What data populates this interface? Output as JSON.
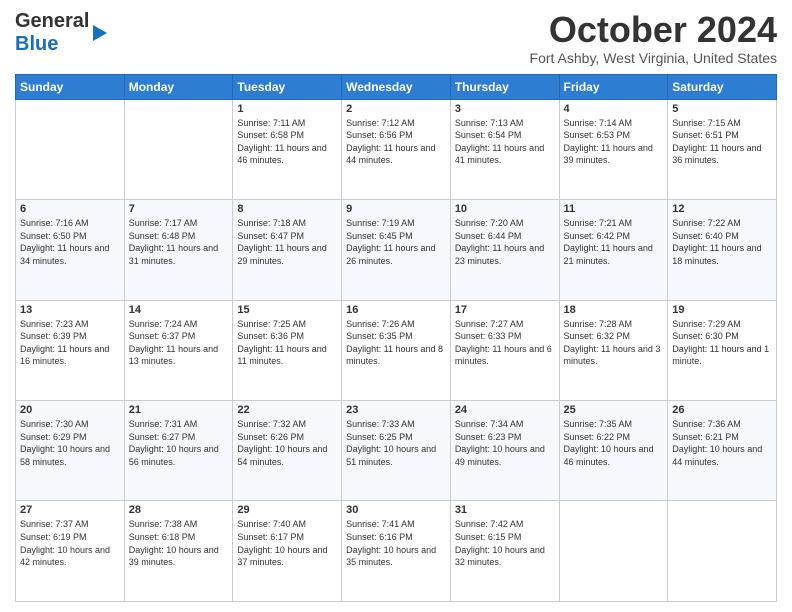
{
  "header": {
    "logo_general": "General",
    "logo_blue": "Blue",
    "title": "October 2024",
    "location": "Fort Ashby, West Virginia, United States"
  },
  "columns": [
    "Sunday",
    "Monday",
    "Tuesday",
    "Wednesday",
    "Thursday",
    "Friday",
    "Saturday"
  ],
  "weeks": [
    [
      {
        "day": "",
        "info": ""
      },
      {
        "day": "",
        "info": ""
      },
      {
        "day": "1",
        "info": "Sunrise: 7:11 AM\nSunset: 6:58 PM\nDaylight: 11 hours and 46 minutes."
      },
      {
        "day": "2",
        "info": "Sunrise: 7:12 AM\nSunset: 6:56 PM\nDaylight: 11 hours and 44 minutes."
      },
      {
        "day": "3",
        "info": "Sunrise: 7:13 AM\nSunset: 6:54 PM\nDaylight: 11 hours and 41 minutes."
      },
      {
        "day": "4",
        "info": "Sunrise: 7:14 AM\nSunset: 6:53 PM\nDaylight: 11 hours and 39 minutes."
      },
      {
        "day": "5",
        "info": "Sunrise: 7:15 AM\nSunset: 6:51 PM\nDaylight: 11 hours and 36 minutes."
      }
    ],
    [
      {
        "day": "6",
        "info": "Sunrise: 7:16 AM\nSunset: 6:50 PM\nDaylight: 11 hours and 34 minutes."
      },
      {
        "day": "7",
        "info": "Sunrise: 7:17 AM\nSunset: 6:48 PM\nDaylight: 11 hours and 31 minutes."
      },
      {
        "day": "8",
        "info": "Sunrise: 7:18 AM\nSunset: 6:47 PM\nDaylight: 11 hours and 29 minutes."
      },
      {
        "day": "9",
        "info": "Sunrise: 7:19 AM\nSunset: 6:45 PM\nDaylight: 11 hours and 26 minutes."
      },
      {
        "day": "10",
        "info": "Sunrise: 7:20 AM\nSunset: 6:44 PM\nDaylight: 11 hours and 23 minutes."
      },
      {
        "day": "11",
        "info": "Sunrise: 7:21 AM\nSunset: 6:42 PM\nDaylight: 11 hours and 21 minutes."
      },
      {
        "day": "12",
        "info": "Sunrise: 7:22 AM\nSunset: 6:40 PM\nDaylight: 11 hours and 18 minutes."
      }
    ],
    [
      {
        "day": "13",
        "info": "Sunrise: 7:23 AM\nSunset: 6:39 PM\nDaylight: 11 hours and 16 minutes."
      },
      {
        "day": "14",
        "info": "Sunrise: 7:24 AM\nSunset: 6:37 PM\nDaylight: 11 hours and 13 minutes."
      },
      {
        "day": "15",
        "info": "Sunrise: 7:25 AM\nSunset: 6:36 PM\nDaylight: 11 hours and 11 minutes."
      },
      {
        "day": "16",
        "info": "Sunrise: 7:26 AM\nSunset: 6:35 PM\nDaylight: 11 hours and 8 minutes."
      },
      {
        "day": "17",
        "info": "Sunrise: 7:27 AM\nSunset: 6:33 PM\nDaylight: 11 hours and 6 minutes."
      },
      {
        "day": "18",
        "info": "Sunrise: 7:28 AM\nSunset: 6:32 PM\nDaylight: 11 hours and 3 minutes."
      },
      {
        "day": "19",
        "info": "Sunrise: 7:29 AM\nSunset: 6:30 PM\nDaylight: 11 hours and 1 minute."
      }
    ],
    [
      {
        "day": "20",
        "info": "Sunrise: 7:30 AM\nSunset: 6:29 PM\nDaylight: 10 hours and 58 minutes."
      },
      {
        "day": "21",
        "info": "Sunrise: 7:31 AM\nSunset: 6:27 PM\nDaylight: 10 hours and 56 minutes."
      },
      {
        "day": "22",
        "info": "Sunrise: 7:32 AM\nSunset: 6:26 PM\nDaylight: 10 hours and 54 minutes."
      },
      {
        "day": "23",
        "info": "Sunrise: 7:33 AM\nSunset: 6:25 PM\nDaylight: 10 hours and 51 minutes."
      },
      {
        "day": "24",
        "info": "Sunrise: 7:34 AM\nSunset: 6:23 PM\nDaylight: 10 hours and 49 minutes."
      },
      {
        "day": "25",
        "info": "Sunrise: 7:35 AM\nSunset: 6:22 PM\nDaylight: 10 hours and 46 minutes."
      },
      {
        "day": "26",
        "info": "Sunrise: 7:36 AM\nSunset: 6:21 PM\nDaylight: 10 hours and 44 minutes."
      }
    ],
    [
      {
        "day": "27",
        "info": "Sunrise: 7:37 AM\nSunset: 6:19 PM\nDaylight: 10 hours and 42 minutes."
      },
      {
        "day": "28",
        "info": "Sunrise: 7:38 AM\nSunset: 6:18 PM\nDaylight: 10 hours and 39 minutes."
      },
      {
        "day": "29",
        "info": "Sunrise: 7:40 AM\nSunset: 6:17 PM\nDaylight: 10 hours and 37 minutes."
      },
      {
        "day": "30",
        "info": "Sunrise: 7:41 AM\nSunset: 6:16 PM\nDaylight: 10 hours and 35 minutes."
      },
      {
        "day": "31",
        "info": "Sunrise: 7:42 AM\nSunset: 6:15 PM\nDaylight: 10 hours and 32 minutes."
      },
      {
        "day": "",
        "info": ""
      },
      {
        "day": "",
        "info": ""
      }
    ]
  ]
}
